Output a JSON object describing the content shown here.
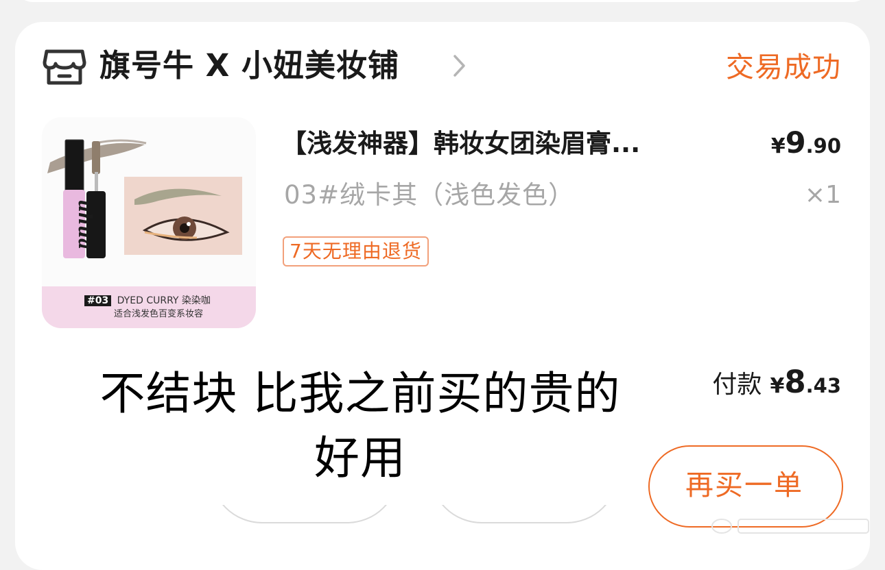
{
  "shop": {
    "name": "旗号牛 X 小妞美妆铺",
    "status": "交易成功"
  },
  "product": {
    "title": "【浅发神器】韩妆女团染眉膏...",
    "price": {
      "currency": "¥",
      "integer": "9",
      "decimal": ".90"
    },
    "variant": "03#绒卡其（浅色发色）",
    "quantity": "×1",
    "tag": "7天无理由退货",
    "image_text": {
      "brand": "uhua",
      "code": "#03",
      "name": "DYED CURRY 染染咖",
      "desc": "适合浅发色百变系妆容"
    }
  },
  "payment": {
    "label": "付款",
    "currency": "¥",
    "integer": "8",
    "decimal": ".43"
  },
  "buttons": {
    "rebuy": "再买一单"
  },
  "caption": {
    "line1": "不结块 比我之前买的贵的",
    "line2": "好用"
  },
  "colors": {
    "accent": "#ee6a24",
    "muted": "#a6a6a6"
  },
  "icons": {
    "shop": "store-icon",
    "chevron": "chevron-right-icon"
  }
}
